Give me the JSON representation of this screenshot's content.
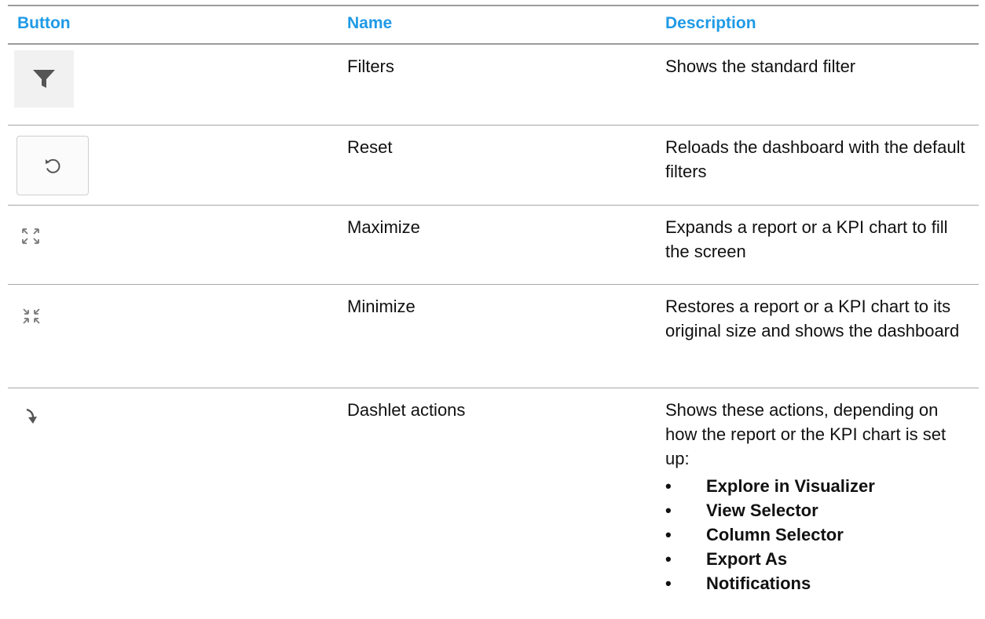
{
  "table": {
    "headers": {
      "button": "Button",
      "name": "Name",
      "description": "Description"
    },
    "rows": [
      {
        "icon": "filter-icon",
        "name": "Filters",
        "description": "Shows the standard filter"
      },
      {
        "icon": "reset-icon",
        "name": "Reset",
        "description": "Reloads the dashboard with the default filters"
      },
      {
        "icon": "maximize-icon",
        "name": "Maximize",
        "description": "Expands a report or a KPI chart to fill the screen"
      },
      {
        "icon": "minimize-icon",
        "name": "Minimize",
        "description": "Restores a report or a KPI chart to its original size and shows the dashboard"
      },
      {
        "icon": "dashlet-actions-icon",
        "name": "Dashlet actions",
        "description": "Shows these actions, depending on how the report or the KPI chart is set up:",
        "actions": [
          "Explore in Visualizer",
          "View Selector",
          "Column Selector",
          "Export As",
          "Notifications"
        ]
      }
    ]
  },
  "colors": {
    "header_text": "#1f9ae6",
    "rule": "#9b9b9b",
    "text": "#111111"
  }
}
